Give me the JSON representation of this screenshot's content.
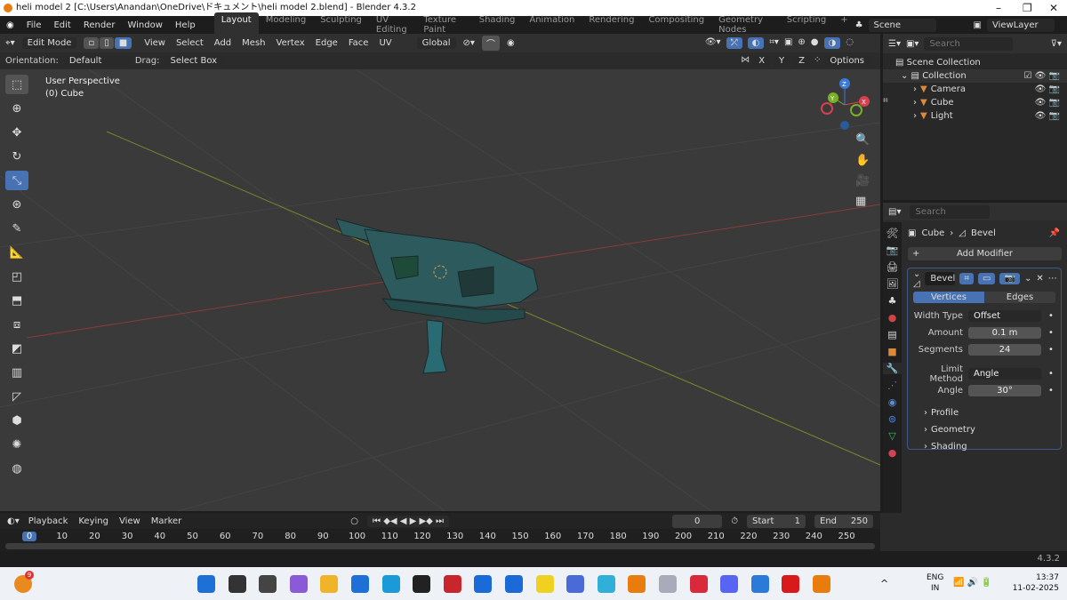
{
  "window": {
    "title": "heli model 2 [C:\\Users\\Anandan\\OneDrive\\ドキュメント\\heli model 2.blend] - Blender 4.3.2"
  },
  "menu": [
    "File",
    "Edit",
    "Render",
    "Window",
    "Help"
  ],
  "workspaces": [
    "Layout",
    "Modeling",
    "Sculpting",
    "UV Editing",
    "Texture Paint",
    "Shading",
    "Animation",
    "Rendering",
    "Compositing",
    "Geometry Nodes",
    "Scripting",
    "+"
  ],
  "scene": "Scene",
  "view_layer": "ViewLayer",
  "viewport_header": {
    "mode": "Edit Mode",
    "menus": [
      "View",
      "Select",
      "Add",
      "Mesh",
      "Vertex",
      "Edge",
      "Face",
      "UV"
    ],
    "transform": "Global"
  },
  "tool_settings": {
    "orientation_label": "Orientation:",
    "orientation": "Default",
    "drag_label": "Drag:",
    "drag": "Select Box",
    "axes": [
      "X",
      "Y",
      "Z"
    ],
    "options": "Options"
  },
  "viewport": {
    "line1": "User Perspective",
    "line2": "(0) Cube",
    "gizmo": [
      "X",
      "Y",
      "Z"
    ]
  },
  "outliner": {
    "search_placeholder": "Search",
    "root": "Scene Collection",
    "collection": "Collection",
    "items": [
      {
        "name": "Camera",
        "color": "#e0883a"
      },
      {
        "name": "Cube",
        "color": "#e0883a"
      },
      {
        "name": "Light",
        "color": "#e0883a"
      }
    ]
  },
  "properties": {
    "search_placeholder": "Search",
    "breadcrumb_object": "Cube",
    "breadcrumb_modifier": "Bevel",
    "add_modifier": "Add Modifier",
    "modifier_name": "Bevel",
    "affect_tabs": [
      "Vertices",
      "Edges"
    ],
    "fields": [
      {
        "label": "Width Type",
        "value": "Offset",
        "type": "dropdown"
      },
      {
        "label": "Amount",
        "value": "0.1 m",
        "type": "number"
      },
      {
        "label": "Segments",
        "value": "24",
        "type": "number"
      },
      {
        "label": "Limit Method",
        "value": "Angle",
        "type": "dropdown"
      },
      {
        "label": "Angle",
        "value": "30°",
        "type": "number"
      }
    ],
    "subpanels": [
      "Profile",
      "Geometry",
      "Shading"
    ]
  },
  "timeline": {
    "menus": [
      "Playback",
      "Keying",
      "View",
      "Marker"
    ],
    "current_frame": "0",
    "start_label": "Start",
    "start": "1",
    "end_label": "End",
    "end": "250",
    "ticks": [
      "0",
      "10",
      "20",
      "30",
      "40",
      "50",
      "60",
      "70",
      "80",
      "90",
      "100",
      "110",
      "120",
      "130",
      "140",
      "150",
      "160",
      "170",
      "180",
      "190",
      "200",
      "210",
      "220",
      "230",
      "240",
      "250"
    ]
  },
  "status": {
    "version": "4.3.2"
  },
  "taskbar": {
    "weather_badge": "9",
    "lang1": "ENG",
    "lang2": "IN",
    "time": "13:37",
    "date": "11-02-2025"
  },
  "colors": {
    "accent": "#4772b3",
    "header": "#303030",
    "viewport": "#3a3a3a",
    "mesh": "#2d5a5c"
  }
}
